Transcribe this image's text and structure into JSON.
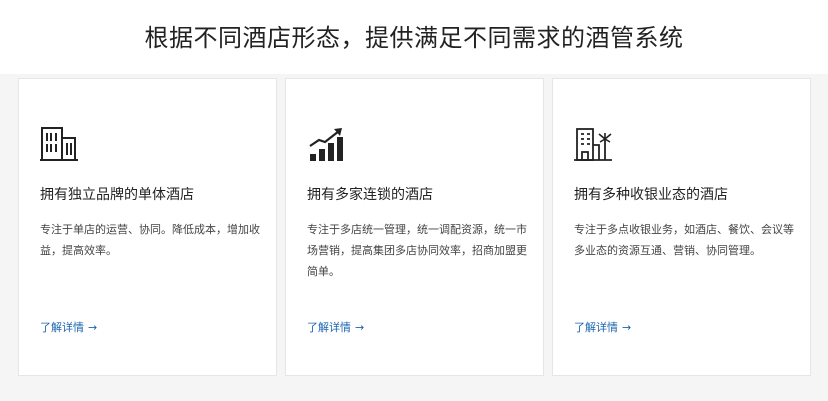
{
  "header": {
    "title": "根据不同酒店形态，提供满足不同需求的酒管系统"
  },
  "cards": [
    {
      "icon": "building-icon",
      "title": "拥有独立品牌的单体酒店",
      "description": "专注于单店的运营、协同。降低成本，增加收益，提高效率。",
      "link_label": "了解详情",
      "link_arrow": "→"
    },
    {
      "icon": "growth-chart-icon",
      "title": "拥有多家连锁的酒店",
      "description": "专注于多店统一管理，统一调配资源，统一市场营销，提高集团多店协同效率，招商加盟更简单。",
      "link_label": "了解详情",
      "link_arrow": "→"
    },
    {
      "icon": "resort-icon",
      "title": "拥有多种收银业态的酒店",
      "description": "专注于多点收银业务，如酒店、餐饮、会议等多业态的资源互通、营销、协同管理。",
      "link_label": "了解详情",
      "link_arrow": "→"
    }
  ],
  "colors": {
    "link": "#1a64b0",
    "background": "#f5f5f5",
    "card_border": "#e6e6e6"
  }
}
